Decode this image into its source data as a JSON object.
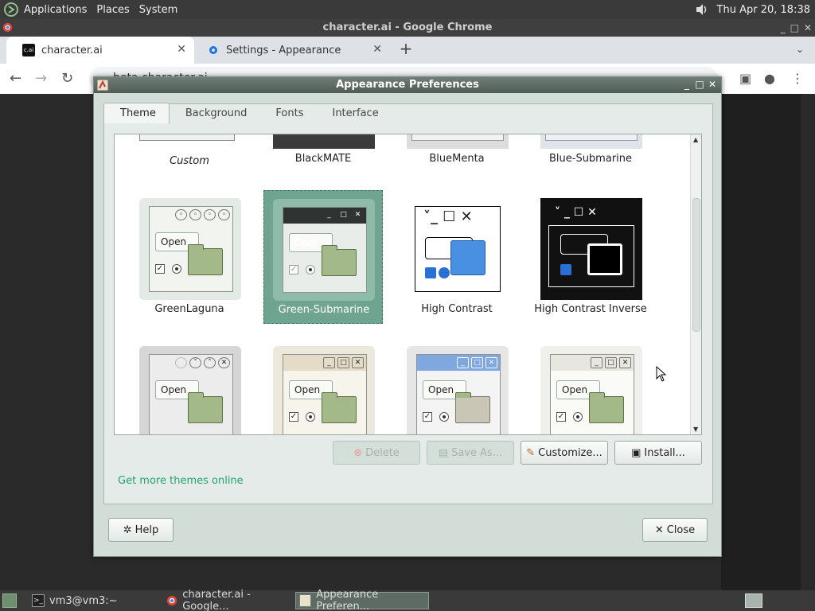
{
  "top_panel": {
    "menus": [
      "Applications",
      "Places",
      "System"
    ],
    "clock": "Thu Apr 20, 18:38"
  },
  "chrome": {
    "window_title": "character.ai - Google Chrome",
    "tabs": [
      {
        "title": "character.ai",
        "favicon": "c.ai"
      },
      {
        "title": "Settings - Appearance",
        "favicon": "gear-icon"
      }
    ],
    "url": "beta.character.ai"
  },
  "dialog": {
    "title": "Appearance Preferences",
    "tabs": [
      "Theme",
      "Background",
      "Fonts",
      "Interface"
    ],
    "active_tab": "Theme",
    "themes_row0": [
      "Custom",
      "BlackMATE",
      "BlueMenta",
      "Blue-Submarine"
    ],
    "themes_row1": [
      "GreenLaguna",
      "Green-Submarine",
      "High Contrast",
      "High Contrast Inverse"
    ],
    "selected_theme": "Green-Submarine",
    "open_label": "Open",
    "buttons": {
      "delete": "Delete",
      "save_as": "Save As...",
      "customize": "Customize...",
      "install": "Install...",
      "help": "Help",
      "close": "Close"
    },
    "link": "Get more themes online"
  },
  "taskbar": {
    "items": [
      "vm3@vm3:~",
      "character.ai - Google...",
      "Appearance Preferen..."
    ]
  },
  "colors": {
    "selection": "#6fa590",
    "link": "#25a36a",
    "dialog_bg": "#d3ddd8"
  }
}
